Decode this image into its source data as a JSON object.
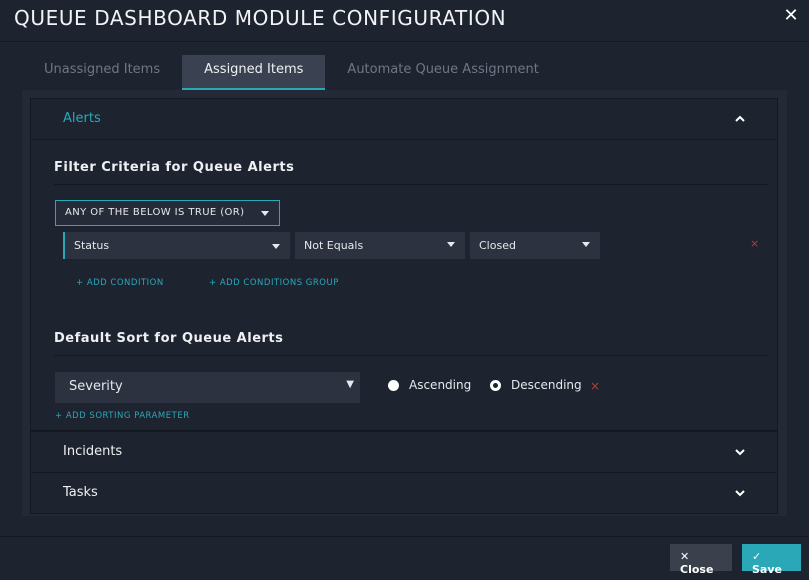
{
  "header": {
    "title": "QUEUE DASHBOARD MODULE CONFIGURATION",
    "close_icon": "close-icon"
  },
  "tabs": [
    {
      "label": "Unassigned Items",
      "active": false
    },
    {
      "label": "Assigned Items",
      "active": true
    },
    {
      "label": "Automate Queue Assignment",
      "active": false
    }
  ],
  "alerts": {
    "title": "Alerts",
    "expanded": true,
    "filter": {
      "title": "Filter Criteria for Queue Alerts",
      "logic_label": "ANY OF THE BELOW IS TRUE (OR)",
      "condition": {
        "field": "Status",
        "operator": "Not Equals",
        "value": "Closed",
        "delete_icon": "×"
      },
      "add_condition": "+ ADD CONDITION",
      "add_group": "+ ADD CONDITIONS GROUP"
    },
    "sort": {
      "title": "Default Sort for Queue Alerts",
      "field": "Severity",
      "ascending_label": "Ascending",
      "descending_label": "Descending",
      "selected": "Descending",
      "delete_icon": "×",
      "add_sort": "+ ADD SORTING PARAMETER"
    }
  },
  "incidents": {
    "title": "Incidents",
    "expanded": false
  },
  "tasks": {
    "title": "Tasks",
    "expanded": false
  },
  "footer": {
    "close_label": "Close",
    "save_label": "Save"
  },
  "colors": {
    "accent": "#2aa8b8",
    "background": "#1e2330",
    "danger": "#c0392b"
  }
}
